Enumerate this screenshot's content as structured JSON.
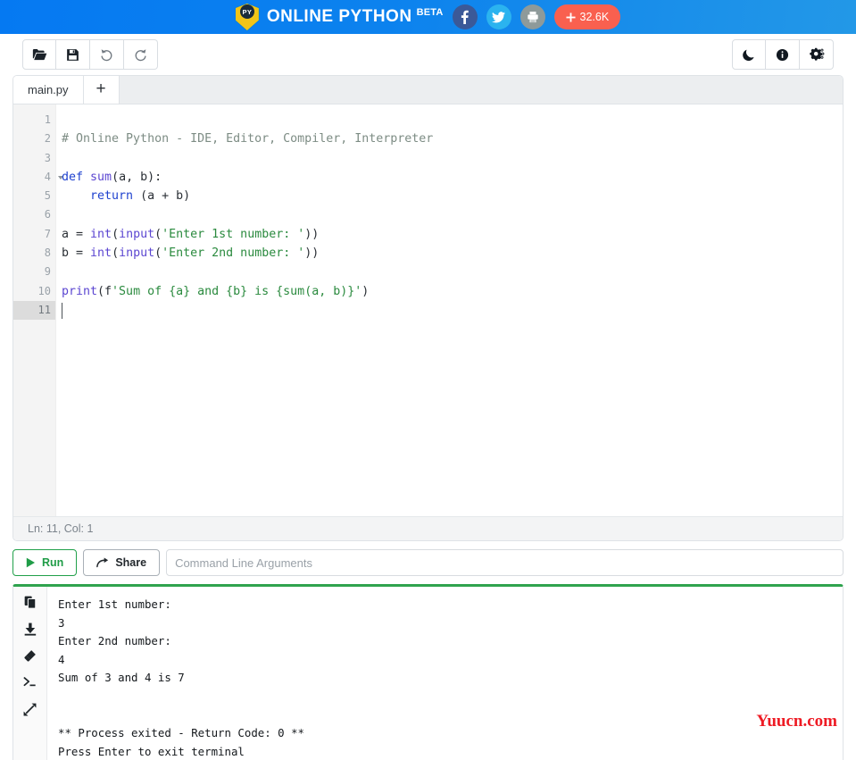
{
  "header": {
    "brand": "ONLINE PYTHON",
    "beta": "BETA",
    "logo_badge": "PY",
    "social": [
      {
        "name": "facebook-button",
        "icon": "facebook-icon",
        "label": "f",
        "color": "#3b5998"
      },
      {
        "name": "twitter-button",
        "icon": "twitter-icon",
        "label": "",
        "color": "#2bb3ef"
      },
      {
        "name": "print-button",
        "icon": "print-icon",
        "label": "",
        "color": "#8e9a9a"
      }
    ],
    "followers": {
      "icon": "plus-icon",
      "count": "32.6K",
      "color": "#f9604f"
    }
  },
  "toolbar": {
    "left": [
      {
        "name": "open-file-button",
        "icon": "folder-open-icon",
        "title": "Open"
      },
      {
        "name": "save-file-button",
        "icon": "save-floppy-icon",
        "title": "Save"
      },
      {
        "name": "undo-button",
        "icon": "undo-icon",
        "title": "Undo"
      },
      {
        "name": "redo-button",
        "icon": "redo-icon",
        "title": "Redo"
      }
    ],
    "right": [
      {
        "name": "dark-mode-button",
        "icon": "moon-icon",
        "title": "Dark mode"
      },
      {
        "name": "info-button",
        "icon": "info-icon",
        "title": "Info"
      },
      {
        "name": "settings-button",
        "icon": "gears-icon",
        "title": "Settings"
      }
    ]
  },
  "editor": {
    "tab_label": "main.py",
    "add_tab_label": "+",
    "status": "Ln: 11,  Col: 1",
    "active_line": 11,
    "fold_line": 4,
    "lines": [
      {
        "n": 1,
        "text": ""
      },
      {
        "n": 2,
        "text": "# Online Python - IDE, Editor, Compiler, Interpreter"
      },
      {
        "n": 3,
        "text": ""
      },
      {
        "n": 4,
        "text": "def sum(a, b):"
      },
      {
        "n": 5,
        "text": "    return (a + b)"
      },
      {
        "n": 6,
        "text": ""
      },
      {
        "n": 7,
        "text": "a = int(input('Enter 1st number: '))"
      },
      {
        "n": 8,
        "text": "b = int(input('Enter 2nd number: '))"
      },
      {
        "n": 9,
        "text": ""
      },
      {
        "n": 10,
        "text": "print(f'Sum of {a} and {b} is {sum(a, b)}')"
      },
      {
        "n": 11,
        "text": ""
      }
    ]
  },
  "run_bar": {
    "run_label": "Run",
    "run_icon": "play-triangle-icon",
    "share_label": "Share",
    "share_icon": "share-arrow-icon",
    "cli_placeholder": "Command Line Arguments",
    "cli_value": ""
  },
  "output": {
    "sidebar": [
      {
        "name": "copy-output-button",
        "icon": "copy-icon"
      },
      {
        "name": "download-output-button",
        "icon": "download-icon"
      },
      {
        "name": "clear-output-button",
        "icon": "eraser-icon"
      },
      {
        "name": "terminal-button",
        "icon": "terminal-prompt-icon"
      },
      {
        "name": "expand-output-button",
        "icon": "expand-arrows-icon"
      }
    ],
    "console_text": "Enter 1st number:\n3\nEnter 2nd number:\n4\nSum of 3 and 4 is 7\n\n\n** Process exited - Return Code: 0 **\nPress Enter to exit terminal",
    "watermark": "Yuucn.com"
  },
  "colors": {
    "header_start": "#0579f2",
    "header_end": "#2398e7",
    "accent_green": "#2fa34e",
    "followers_red": "#f9604f",
    "watermark_red": "#ee1b24"
  }
}
